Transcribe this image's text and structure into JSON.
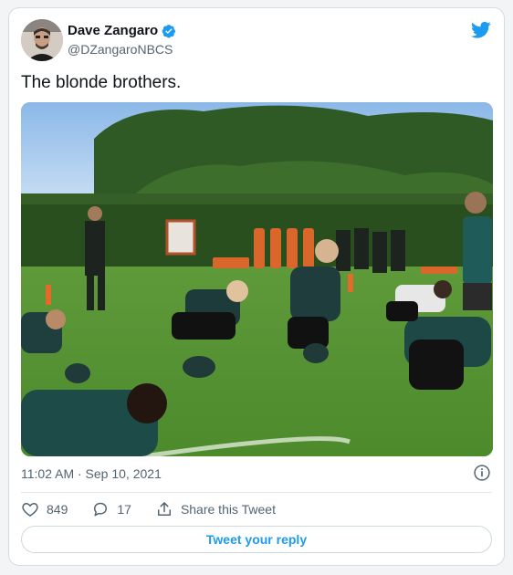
{
  "author": {
    "name": "Dave Zangaro",
    "handle": "@DZangaroNBCS"
  },
  "tweet": {
    "text": "The blonde brothers."
  },
  "meta": {
    "timestamp": "11:02 AM · Sep 10, 2021"
  },
  "actions": {
    "likes": "849",
    "replies": "17",
    "share_label": "Share this Tweet"
  },
  "reply": {
    "label": "Tweet your reply"
  },
  "colors": {
    "accent": "#1d9bf0",
    "verified": "#1d9bf0",
    "text": "#0f1419",
    "muted": "#536471"
  },
  "icons": [
    "verified-badge-icon",
    "twitter-bird-icon",
    "info-icon",
    "heart-icon",
    "reply-icon",
    "share-icon"
  ]
}
